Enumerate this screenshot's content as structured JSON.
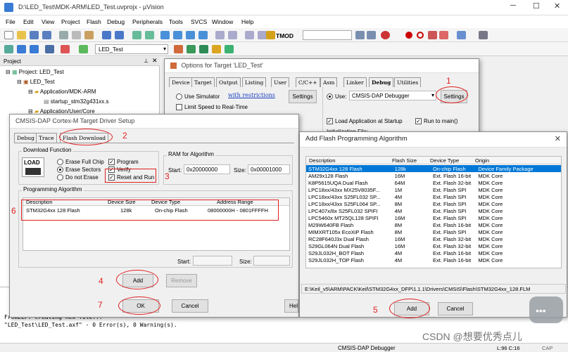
{
  "window": {
    "title": "D:\\LED_Test\\MDK-ARM\\LED_Test.uvprojx - µVision"
  },
  "menu": [
    "File",
    "Edit",
    "View",
    "Project",
    "Flash",
    "Debug",
    "Peripherals",
    "Tools",
    "SVCS",
    "Window",
    "Help"
  ],
  "toolbar": {
    "target_name": "TMOD",
    "target_select": "LED_Test"
  },
  "project_panel": {
    "header": "Project",
    "tree": [
      "Project: LED_Test",
      "LED_Test",
      "Application/MDK-ARM",
      "startup_stm32g431xx.s",
      "Application/User/Core"
    ]
  },
  "output": {
    "lines": [
      "FromELF: creating hex file...",
      "\"LED_Test\\LED_Test.axf\" - 0 Error(s), 0 Warning(s)."
    ]
  },
  "status": {
    "debugger": "CMSIS-DAP Debugger",
    "position": "L:96 C:16",
    "caps": "CAP",
    "watermark": "CSDN @想要优秀点儿"
  },
  "options_dialog": {
    "title": "Options for Target 'LED_Test'",
    "tabs": [
      "Device",
      "Target",
      "Output",
      "Listing",
      "User",
      "C/C++",
      "Asm",
      "Linker",
      "Debug",
      "Utilities"
    ],
    "use_simulator": "Use Simulator",
    "restrictions_link": "with restrictions",
    "settings_label": "Settings",
    "limit_speed": "Limit Speed to Real-Time",
    "use_label": "Use:",
    "debugger": "CMSIS-DAP Debugger",
    "load_app": "Load Application at Startup",
    "run_to_main": "Run to main()",
    "init_file": "Initialization File:"
  },
  "cmsis_dialog": {
    "title": "CMSIS-DAP Cortex-M Target Driver Setup",
    "tabs": [
      "Debug",
      "Trace",
      "Flash Download"
    ],
    "download_function": "Download Function",
    "load_label": "LOAD",
    "erase_full": "Erase Full Chip",
    "erase_sectors": "Erase Sectors",
    "do_not_erase": "Do not Erase",
    "program": "Program",
    "verify": "Verify",
    "reset_and_run": "Reset and Run",
    "ram_group": "RAM for Algorithm",
    "start_label": "Start:",
    "start_value": "0x20000000",
    "size_label": "Size:",
    "size_value": "0x00001000",
    "prog_algo_group": "Programming Algorithm",
    "columns": [
      "Description",
      "Device Size",
      "Device Type",
      "Address Range"
    ],
    "row": [
      "STM32G4xx 128 Flash",
      "128k",
      "On-chip Flash",
      "08000000H - 0801FFFFH"
    ],
    "start2_label": "Start:",
    "size2_label": "Size:",
    "add_label": "Add",
    "remove_label": "Remove",
    "ok_label": "OK",
    "cancel_label": "Cancel",
    "help_label": "Help"
  },
  "add_flash_dialog": {
    "title": "Add Flash Programming Algorithm",
    "columns": [
      "Description",
      "Flash Size",
      "Device Type",
      "Origin"
    ],
    "rows": [
      [
        "STM32G4xx 128 Flash",
        "128k",
        "On-chip Flash",
        "Device Family Package"
      ],
      [
        "AM29x128 Flash",
        "16M",
        "Ext. Flash 16-bit",
        "MDK Core"
      ],
      [
        "K8P5615UQA Dual Flash",
        "64M",
        "Ext. Flash 32-bit",
        "MDK Core"
      ],
      [
        "LPC18xx/43xx MX25V8035F...",
        "1M",
        "Ext. Flash SPI",
        "MDK Core"
      ],
      [
        "LPC18xx/43xx S25FL032 SP...",
        "4M",
        "Ext. Flash SPI",
        "MDK Core"
      ],
      [
        "LPC18xx/43xx S25FL064 SP...",
        "8M",
        "Ext. Flash SPI",
        "MDK Core"
      ],
      [
        "LPC407x/8x S25FL032 SPIFI",
        "4M",
        "Ext. Flash SPI",
        "MDK Core"
      ],
      [
        "LPC5460x MT25QL128 SPIFI",
        "16M",
        "Ext. Flash SPI",
        "MDK Core"
      ],
      [
        "M29W640FB Flash",
        "8M",
        "Ext. Flash 16-bit",
        "MDK Core"
      ],
      [
        "MIMXRT105x EcoXiP Flash",
        "8M",
        "Ext. Flash SPI",
        "MDK Core"
      ],
      [
        "RC28F640J3x Dual Flash",
        "16M",
        "Ext. Flash 32-bit",
        "MDK Core"
      ],
      [
        "S29GL064N Dual Flash",
        "16M",
        "Ext. Flash 32-bit",
        "MDK Core"
      ],
      [
        "S29JL032H_BOT Flash",
        "4M",
        "Ext. Flash 16-bit",
        "MDK Core"
      ],
      [
        "S29JL032H_TOP Flash",
        "4M",
        "Ext. Flash 16-bit",
        "MDK Core"
      ]
    ],
    "path": "E:\\Keil_v5\\ARM\\PACK\\Keil\\STM32G4xx_DFP\\1.1.1\\Drivers\\CMSIS\\Flash\\STM32G4xx_128.FLM",
    "add_label": "Add",
    "cancel_label": "Cancel"
  },
  "annotations": [
    "1",
    "2",
    "3",
    "4",
    "5",
    "6",
    "7"
  ],
  "colors": {
    "annotation": "#e02020",
    "selection": "#0078d7",
    "title_bg": "#ffffff"
  }
}
